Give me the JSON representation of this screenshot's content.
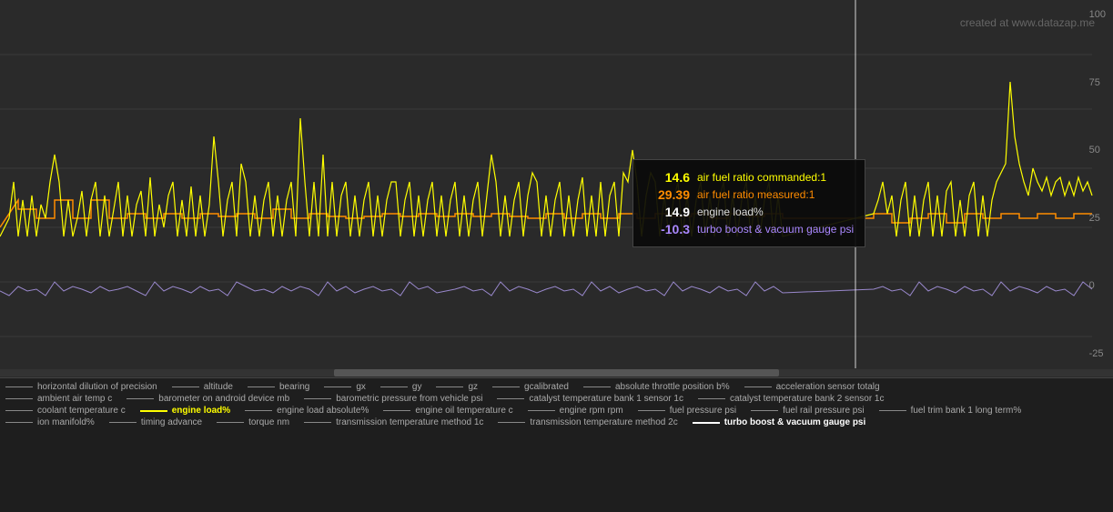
{
  "watermark": "created at www.datazap.me",
  "yAxis": {
    "labels": [
      "100",
      "75",
      "50",
      "25",
      "0",
      "-25"
    ]
  },
  "tooltip": {
    "rows": [
      {
        "value": "14.6",
        "label": "air fuel ratio commanded:1",
        "valueClass": "tv-yellow",
        "labelClass": "tl-yellow"
      },
      {
        "value": "29.39",
        "label": "air fuel ratio measured:1",
        "valueClass": "tv-orange",
        "labelClass": "tl-orange"
      },
      {
        "value": "14.9",
        "label": "engine load%",
        "valueClass": "tv-white",
        "labelClass": "tl-white"
      },
      {
        "value": "-10.3",
        "label": "turbo boost & vacuum gauge psi",
        "valueClass": "tv-purple",
        "labelClass": "tl-purple"
      }
    ]
  },
  "legend": {
    "rows": [
      [
        {
          "label": "horizontal dilution of precision",
          "color": "#888",
          "thick": false
        },
        {
          "label": "altitude",
          "color": "#888",
          "thick": false
        },
        {
          "label": "bearing",
          "color": "#888",
          "thick": false
        },
        {
          "label": "gx",
          "color": "#888",
          "thick": false
        },
        {
          "label": "gy",
          "color": "#888",
          "thick": false
        },
        {
          "label": "gz",
          "color": "#888",
          "thick": false
        },
        {
          "label": "gcalibrated",
          "color": "#888",
          "thick": false
        },
        {
          "label": "absolute throttle position b%",
          "color": "#888",
          "thick": false
        },
        {
          "label": "acceleration sensor totalg",
          "color": "#888",
          "thick": false
        }
      ],
      [
        {
          "label": "ambient air temp c",
          "color": "#888",
          "thick": false
        },
        {
          "label": "barometer on android device mb",
          "color": "#888",
          "thick": false
        },
        {
          "label": "barometric pressure from vehicle psi",
          "color": "#888",
          "thick": false
        },
        {
          "label": "catalyst temperature bank 1 sensor 1c",
          "color": "#888",
          "thick": false
        },
        {
          "label": "catalyst temperature bank 2 sensor 1c",
          "color": "#888",
          "thick": false
        }
      ],
      [
        {
          "label": "coolant temperature c",
          "color": "#888",
          "thick": false
        },
        {
          "label": "engine load%",
          "color": "#ffff00",
          "thick": true
        },
        {
          "label": "engine load absolute%",
          "color": "#888",
          "thick": false
        },
        {
          "label": "engine oil temperature c",
          "color": "#888",
          "thick": false
        },
        {
          "label": "engine rpm rpm",
          "color": "#888",
          "thick": false
        },
        {
          "label": "fuel pressure psi",
          "color": "#888",
          "thick": false
        },
        {
          "label": "fuel rail pressure psi",
          "color": "#888",
          "thick": false
        },
        {
          "label": "fuel trim bank 1 long term%",
          "color": "#888",
          "thick": false
        }
      ],
      [
        {
          "label": "ion manifold%",
          "color": "#888",
          "thick": false
        },
        {
          "label": "timing advance",
          "color": "#888",
          "thick": false
        },
        {
          "label": "torque nm",
          "color": "#888",
          "thick": false
        },
        {
          "label": "transmission temperature method 1c",
          "color": "#888",
          "thick": false
        },
        {
          "label": "transmission temperature method 2c",
          "color": "#888",
          "thick": false
        },
        {
          "label": "turbo boost & vacuum gauge psi",
          "color": "#ffffff",
          "thick": true
        }
      ]
    ]
  }
}
